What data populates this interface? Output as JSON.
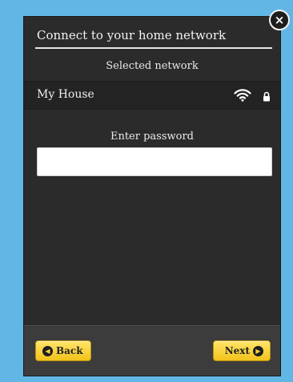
{
  "dialog": {
    "title": "Connect to your home network",
    "selected_label": "Selected network",
    "network_name": "My House",
    "password_label": "Enter password",
    "password_value": "",
    "back_label": "Back",
    "next_label": "Next",
    "close_symbol": "×",
    "icons": {
      "signal": "wifi-icon",
      "secured": "lock-icon",
      "back": "chevron-left-circle-icon",
      "next": "chevron-right-circle-icon",
      "close": "close-icon"
    },
    "colors": {
      "background": "#62b6e6",
      "panel": "#2b2b2b",
      "accent_button": "#f3c21a"
    }
  }
}
